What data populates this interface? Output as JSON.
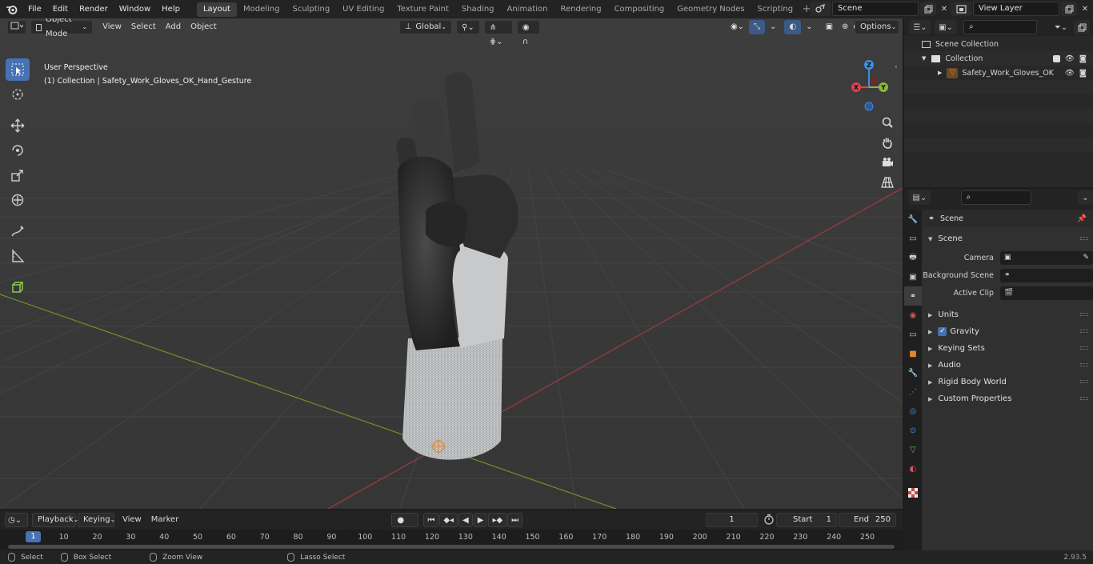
{
  "app": {
    "menu": [
      "File",
      "Edit",
      "Render",
      "Window",
      "Help"
    ],
    "workspaces": [
      "Layout",
      "Modeling",
      "Sculpting",
      "UV Editing",
      "Texture Paint",
      "Shading",
      "Animation",
      "Rendering",
      "Compositing",
      "Geometry Nodes",
      "Scripting"
    ],
    "active_workspace": "Layout",
    "scene_name": "Scene",
    "view_layer": "View Layer"
  },
  "viewport": {
    "mode": "Object Mode",
    "menus": [
      "View",
      "Select",
      "Add",
      "Object"
    ],
    "transform_orientation": "Global",
    "options_label": "Options",
    "info_line1": "User Perspective",
    "info_line2": "(1) Collection | Safety_Work_Gloves_OK_Hand_Gesture",
    "gizmo": {
      "x": "X",
      "y": "Y",
      "z": "Z"
    }
  },
  "outliner": {
    "rows": [
      {
        "label": "Scene Collection"
      },
      {
        "label": "Collection"
      },
      {
        "label": "Safety_Work_Gloves_OK"
      }
    ]
  },
  "properties": {
    "title": "Scene",
    "panel": "Scene",
    "fields": [
      {
        "label": "Camera",
        "value": ""
      },
      {
        "label": "Background Scene",
        "value": ""
      },
      {
        "label": "Active Clip",
        "value": ""
      }
    ],
    "sections": [
      "Units",
      "Gravity",
      "Keying Sets",
      "Audio",
      "Rigid Body World",
      "Custom Properties"
    ]
  },
  "timeline": {
    "menus": [
      "Playback",
      "Keying",
      "View",
      "Marker"
    ],
    "current_frame": "1",
    "start_label": "Start",
    "start": "1",
    "end_label": "End",
    "end": "250",
    "ticks": [
      "1",
      "10",
      "20",
      "30",
      "40",
      "50",
      "60",
      "70",
      "80",
      "90",
      "100",
      "110",
      "120",
      "130",
      "140",
      "150",
      "160",
      "170",
      "180",
      "190",
      "200",
      "210",
      "220",
      "230",
      "240",
      "250"
    ]
  },
  "statusbar": {
    "select": "Select",
    "box_select": "Box Select",
    "zoom_view": "Zoom View",
    "lasso_select": "Lasso Select",
    "version": "2.93.5"
  },
  "colors": {
    "accent": "#4772b3",
    "x_axis": "#d9454f",
    "y_axis": "#8bb83b",
    "z_axis": "#3b8fe0",
    "orange": "#e8862b"
  }
}
